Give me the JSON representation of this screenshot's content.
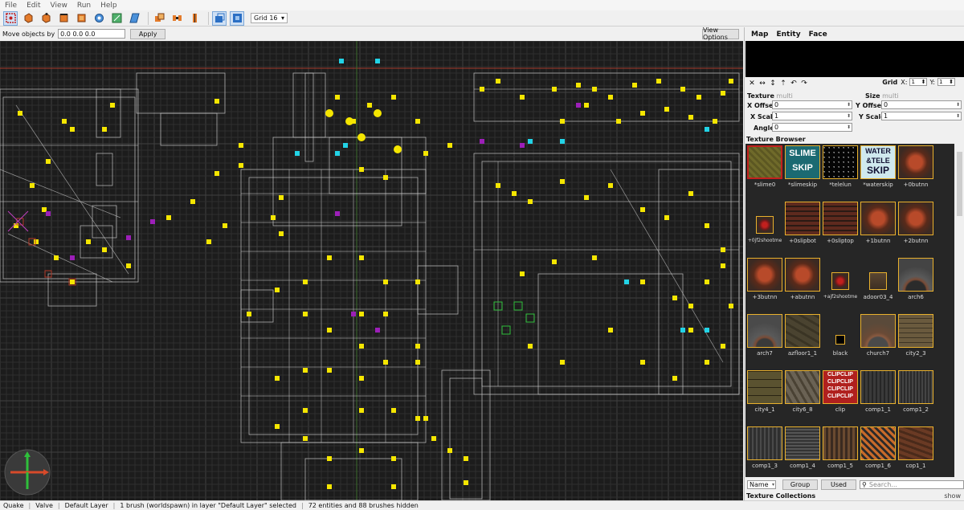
{
  "menu": [
    "File",
    "Edit",
    "View",
    "Run",
    "Help"
  ],
  "toolbar": {
    "grid_select": "Grid 16",
    "tools": [
      "select-tool-icon",
      "brush-tool-icon",
      "vertex-tool-icon",
      "edge-tool-icon",
      "face-tool-icon",
      "rotate-tool-icon",
      "scale-tool-icon",
      "shear-tool-icon",
      "csg-convex-icon",
      "csg-subtract-icon",
      "csg-intersect-icon",
      "texture-lock-icon",
      "uv-lock-icon"
    ]
  },
  "move_bar": {
    "label": "Move objects by",
    "value": "0.0 0.0 0.0",
    "apply": "Apply",
    "view_options": "View Options"
  },
  "panel": {
    "tabs": [
      "Map",
      "Entity",
      "Face"
    ],
    "grid_label": "Grid",
    "grid_x_label": "X:",
    "grid_x": "1",
    "grid_y_label": "Y:",
    "grid_y": "1",
    "texture_label": "Texture",
    "texture_value": "multi",
    "size_label": "Size",
    "size_value": "multi",
    "x_offset_label": "X Offset",
    "x_offset": "0",
    "y_offset_label": "Y Offset",
    "y_offset": "0",
    "x_scale_label": "X Scale",
    "x_scale": "1",
    "y_scale_label": "Y Scale",
    "y_scale": "1",
    "angle_label": "Angle",
    "angle": "0",
    "texture_browser_title": "Texture Browser",
    "sort_select": "Name",
    "group_button": "Group",
    "used_button": "Used",
    "search_placeholder": "Search...",
    "texture_collections": "Texture Collections",
    "show_label": "show"
  },
  "textures": [
    {
      "name": "*slime0",
      "tex": "slime",
      "frame": "sel"
    },
    {
      "name": "*slimeskip",
      "tex": "slimeskip",
      "frame": "frm"
    },
    {
      "name": "*telelun",
      "tex": "stars",
      "frame": "frm"
    },
    {
      "name": "*waterskip",
      "tex": "waterskip",
      "frame": "frm"
    },
    {
      "name": "+0butnn",
      "tex": "quake",
      "frame": "frm"
    },
    {
      "name": "+0jf2shootme",
      "tex": "shootme",
      "frame": "small"
    },
    {
      "name": "+0slipbot",
      "tex": "slip",
      "frame": "frm"
    },
    {
      "name": "+0sliptop",
      "tex": "slip",
      "frame": "frm"
    },
    {
      "name": "+1butnn",
      "tex": "quake",
      "frame": "frm"
    },
    {
      "name": "+2butnn",
      "tex": "quake",
      "frame": "frm"
    },
    {
      "name": "+3butnn",
      "tex": "quake",
      "frame": "frm"
    },
    {
      "name": "+abutnn",
      "tex": "quake",
      "frame": "frm"
    },
    {
      "name": "+ajf2shootme",
      "tex": "shootme",
      "frame": "small"
    },
    {
      "name": "adoor03_4",
      "tex": "door",
      "frame": "smallbox"
    },
    {
      "name": "arch6",
      "tex": "arch",
      "frame": "frm"
    },
    {
      "name": "arch7",
      "tex": "arch7",
      "frame": "frm"
    },
    {
      "name": "azfloor1_1",
      "tex": "stone",
      "frame": "frm"
    },
    {
      "name": "black",
      "tex": "black",
      "frame": "tiny"
    },
    {
      "name": "church7",
      "tex": "church",
      "frame": "frm"
    },
    {
      "name": "city2_3",
      "tex": "brick",
      "frame": "frm"
    },
    {
      "name": "city4_1",
      "tex": "tile",
      "frame": "frm"
    },
    {
      "name": "city6_8",
      "tex": "cobble",
      "frame": "frm"
    },
    {
      "name": "clip",
      "tex": "clip",
      "frame": "frm"
    },
    {
      "name": "comp1_1",
      "tex": "comp",
      "frame": "frm"
    },
    {
      "name": "comp1_2",
      "tex": "comp2",
      "frame": "frm"
    },
    {
      "name": "comp1_3",
      "tex": "comp3",
      "frame": "frm"
    },
    {
      "name": "comp1_4",
      "tex": "comp4",
      "frame": "frm"
    },
    {
      "name": "comp1_5",
      "tex": "comp5",
      "frame": "frm"
    },
    {
      "name": "comp1_6",
      "tex": "comp6",
      "frame": "frm"
    },
    {
      "name": "cop1_1",
      "tex": "copper",
      "frame": "frm"
    }
  ],
  "texture_text": {
    "slimeskip_top": "SLIME",
    "slimeskip_bottom": "SKIP",
    "waterskip_1": "WATER",
    "waterskip_2": "&TELE",
    "waterskip_3": "SKIP",
    "clip_word": "CLIP"
  },
  "status": {
    "game": "Quake",
    "engine": "Valve",
    "layer": "Default Layer",
    "selection": "1 brush (worldspawn) in layer \"Default Layer\" selected",
    "counts": "72 entities and 88 brushes hidden"
  },
  "colors": {
    "viewport_bg": "#1c1c1c",
    "grid_minor": "#2e2e2e",
    "grid_major": "#404040",
    "brush_edge": "#c8c8c8",
    "entity_yellow": "#f5e600",
    "entity_cyan": "#22d3e6",
    "entity_magenta": "#9c1fb8",
    "axis_red": "#a63a2a",
    "selection_red": "#c2201e",
    "texture_frame": "#e9b12d"
  }
}
